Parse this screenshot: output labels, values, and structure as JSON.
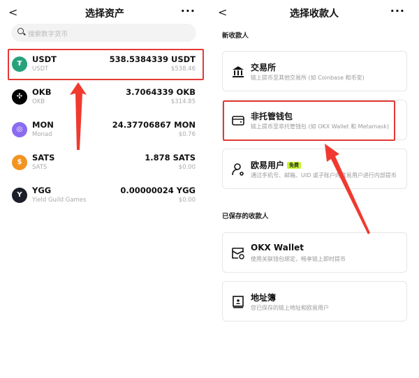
{
  "left": {
    "title": "选择资产",
    "search_placeholder": "搜索数字货币",
    "assets": [
      {
        "symbol": "USDT",
        "name": "USDT",
        "amount": "538.5384339 USDT",
        "usd": "$538.46",
        "color": "#26a17b",
        "glyph": "₮"
      },
      {
        "symbol": "OKB",
        "name": "OKB",
        "amount": "3.7064339 OKB",
        "usd": "$314.85",
        "color": "#000000",
        "glyph": "✣"
      },
      {
        "symbol": "MON",
        "name": "Monad",
        "amount": "24.37706867 MON",
        "usd": "$0.76",
        "color": "#8b6cf0",
        "glyph": "◎"
      },
      {
        "symbol": "SATS",
        "name": "SATS",
        "amount": "1.878 SATS",
        "usd": "$0.00",
        "color": "#f39321",
        "glyph": "$"
      },
      {
        "symbol": "YGG",
        "name": "Yield Guild Games",
        "amount": "0.00000024 YGG",
        "usd": "$0.00",
        "color": "#1c1f2a",
        "glyph": "Y"
      }
    ]
  },
  "right": {
    "title": "选择收款人",
    "new_section": "新收款人",
    "saved_section": "已保存的收款人",
    "new": [
      {
        "title": "交易所",
        "desc": "链上提币至其他交易所 (如 Coinbase 和币安)"
      },
      {
        "title": "非托管钱包",
        "desc": "链上提币至非托管钱包 (如 OKX Wallet 和 Metamask)"
      },
      {
        "title": "欧易用户",
        "badge": "免费",
        "desc": "通过手机号、邮箱、UID 或子账户向欧易用户进行内部提币"
      }
    ],
    "saved": [
      {
        "title": "OKX Wallet",
        "desc": "使用关联钱包绑定，畅享链上即时提币"
      },
      {
        "title": "地址簿",
        "desc": "您已保存的链上地址和欧易用户"
      }
    ]
  },
  "colors": {
    "highlight": "#e53935"
  }
}
